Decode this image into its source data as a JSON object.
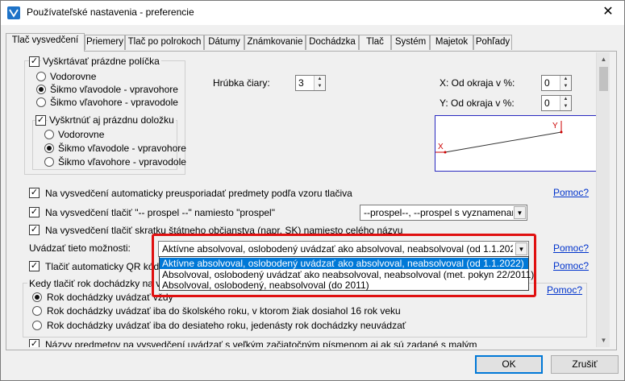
{
  "window": {
    "title": "Používateľské nastavenia - preferencie"
  },
  "tabs": [
    {
      "label": "Tlač vysvedčení"
    },
    {
      "label": "Priemery"
    },
    {
      "label": "Tlač po polrokoch"
    },
    {
      "label": "Dátumy"
    },
    {
      "label": "Známkovanie"
    },
    {
      "label": "Dochádzka"
    },
    {
      "label": "Tlač"
    },
    {
      "label": "Systém"
    },
    {
      "label": "Majetok"
    },
    {
      "label": "Pohľady"
    }
  ],
  "empty_fields": {
    "label": "Vyškrtávať prázdne políčka",
    "options": [
      "Vodorovne",
      "Šikmo vľavodole - vpravohore",
      "Šikmo vľavohore - vpravodole"
    ],
    "sub": {
      "label": "Vyškrtnúť aj prázdnu doložku",
      "options": [
        "Vodorovne",
        "Šikmo vľavodole - vpravohore",
        "Šikmo vľavohore - vpravodole"
      ]
    }
  },
  "line_thickness": {
    "label": "Hrúbka čiary:",
    "value": "3"
  },
  "margin_x": {
    "label": "X: Od okraja v %:",
    "value": "0"
  },
  "margin_y": {
    "label": "Y: Od okraja v %:",
    "value": "0"
  },
  "preview": {
    "x_label": "X",
    "y_label": "Y"
  },
  "options": {
    "reorder_subjects": "Na vysvedčení automaticky preusporiadať predmety podľa vzoru tlačiva",
    "print_prospel": "Na vysvedčení tlačiť \"-- prospel --\" namiesto \"prospel\"",
    "prospel_combo": "--prospel--, --prospel s vyznamenaním--,",
    "print_state_abbr": "Na vysvedčení tlačiť skratku štátneho občianstva (napr. SK) namiesto celého názvu",
    "state_options_label": "Uvádzať tieto možnosti:",
    "state_options_value": "Aktívne absolvoval, oslobodený uvádzať ako absolvoval, neabsolvoval (od 1.1.2022)",
    "qr_label": "Tlačiť automaticky QR kódin",
    "help": "Pomoc?"
  },
  "dropdown": [
    "Aktívne absolvoval, oslobodený uvádzať ako absolvoval, neabsolvoval (od 1.1.2022)",
    "Absolvoval, oslobodený uvádzať ako neabsolvoval, neabsolvoval (met. pokyn 22/2011)",
    "Absolvoval, oslobodený, neabsolvoval (do 2011)"
  ],
  "attendance_year": {
    "label": "Kedy tlačiť rok dochádzky na vy",
    "options": [
      "Rok dochádzky uvádzať vždy",
      "Rok dochádzky uvádzať iba do školského roku, v ktorom žiak dosiahol 16 rok veku",
      "Rok dochádzky uvádzať iba do desiateho roku, jedenásty rok dochádzky neuvádzať"
    ]
  },
  "subject_caps": "Názvy predmetov na vysvedčení uvádzať s veľkým začiatočným písmenom aj ak sú zadané s malým",
  "buttons": {
    "ok": "OK",
    "cancel": "Zrušiť"
  },
  "colors": {
    "selection": "#0078d7",
    "highlight": "#e01010",
    "link": "#0033cc"
  }
}
